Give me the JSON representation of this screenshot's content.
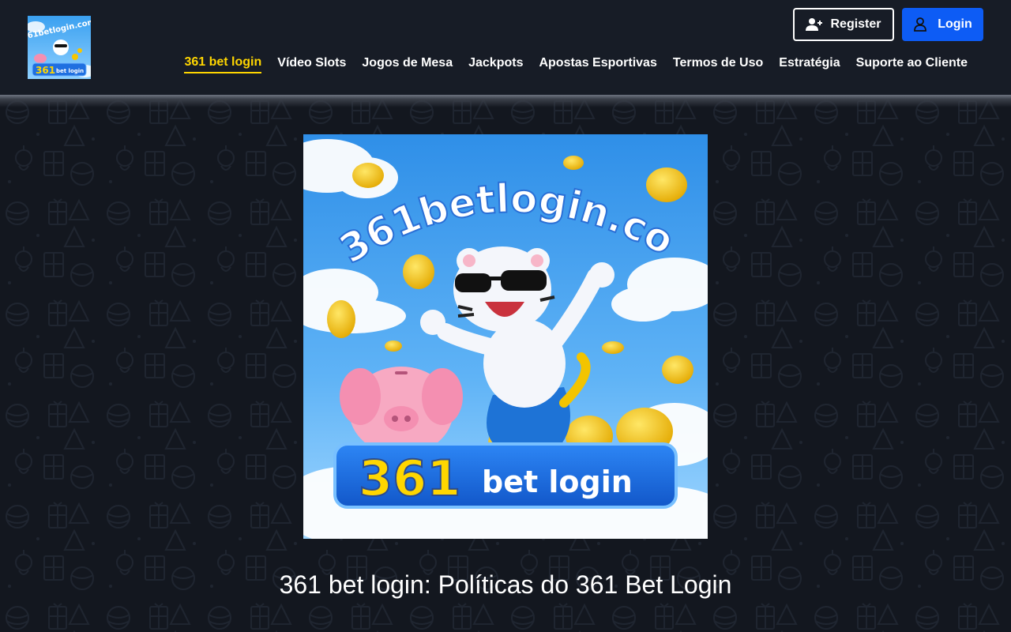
{
  "header": {
    "logo": {
      "text_top": "361betlogin.com",
      "text_badge": "361",
      "text_badge_sub": "bet login"
    },
    "buttons": {
      "register_label": "Register",
      "login_label": "Login"
    },
    "nav": [
      {
        "label": "361 bet login",
        "active": true
      },
      {
        "label": "Vídeo Slots",
        "active": false
      },
      {
        "label": "Jogos de Mesa",
        "active": false
      },
      {
        "label": "Jackpots",
        "active": false
      },
      {
        "label": "Apostas Esportivas",
        "active": false
      },
      {
        "label": "Termos de Uso",
        "active": false
      },
      {
        "label": "Estratégia",
        "active": false
      },
      {
        "label": "Suporte ao Cliente",
        "active": false
      }
    ]
  },
  "hero": {
    "site_text": "361betlogin.com",
    "badge_number": "361",
    "badge_text": "bet login"
  },
  "main": {
    "title": "361 bet login: Políticas do 361 Bet Login"
  },
  "colors": {
    "accent": "#ffd600",
    "login_button": "#0d5cf5",
    "header_bg": "#171c26",
    "page_bg": "#13171f"
  },
  "icons": {
    "register": "user-plus-icon",
    "login": "user-icon"
  }
}
